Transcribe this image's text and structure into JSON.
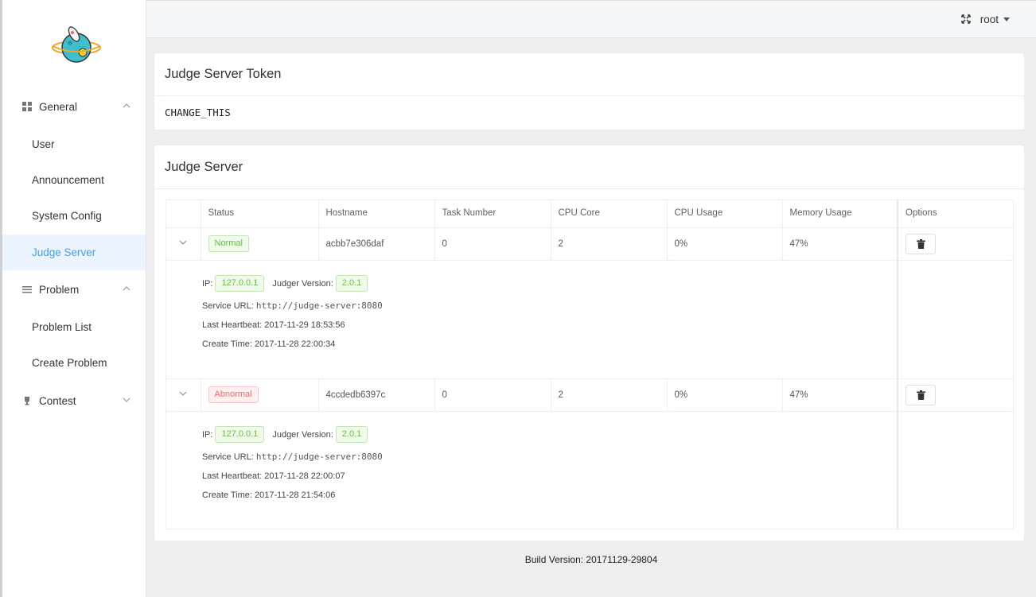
{
  "sidebar": {
    "groups": [
      {
        "label": "General",
        "items": [
          "User",
          "Announcement",
          "System Config",
          "Judge Server"
        ]
      },
      {
        "label": "Problem",
        "items": [
          "Problem List",
          "Create Problem"
        ]
      },
      {
        "label": "Contest",
        "items": []
      }
    ],
    "active_item": "Judge Server"
  },
  "header": {
    "user": "root"
  },
  "token_card": {
    "title": "Judge Server Token",
    "value": "CHANGE_THIS"
  },
  "server_card": {
    "title": "Judge Server",
    "columns": [
      "Status",
      "Hostname",
      "Task Number",
      "CPU Core",
      "CPU Usage",
      "Memory Usage",
      "Options"
    ],
    "rows": [
      {
        "status": "Normal",
        "hostname": "acbb7e306daf",
        "task_number": "0",
        "cpu_core": "2",
        "cpu_usage": "0%",
        "memory_usage": "47%",
        "ip_label": "IP:",
        "ip": "127.0.0.1",
        "version_label": "Judger Version:",
        "version": "2.0.1",
        "service_url_label": "Service URL:",
        "service_url": "http://judge-server:8080",
        "heartbeat": "Last Heartbeat: 2017-11-29 18:53:56",
        "create_time": "Create Time: 2017-11-28 22:00:34"
      },
      {
        "status": "Abnormal",
        "hostname": "4ccdedb6397c",
        "task_number": "0",
        "cpu_core": "2",
        "cpu_usage": "0%",
        "memory_usage": "47%",
        "ip_label": "IP:",
        "ip": "127.0.0.1",
        "version_label": "Judger Version:",
        "version": "2.0.1",
        "service_url_label": "Service URL:",
        "service_url": "http://judge-server:8080",
        "heartbeat": "Last Heartbeat: 2017-11-28 22:00:07",
        "create_time": "Create Time: 2017-11-28 21:54:06"
      }
    ]
  },
  "footer": {
    "build": "Build Version: 20171129-29804"
  },
  "colors": {
    "accent": "#409eff",
    "ok": "#67c23a",
    "bad": "#f56c6c"
  }
}
